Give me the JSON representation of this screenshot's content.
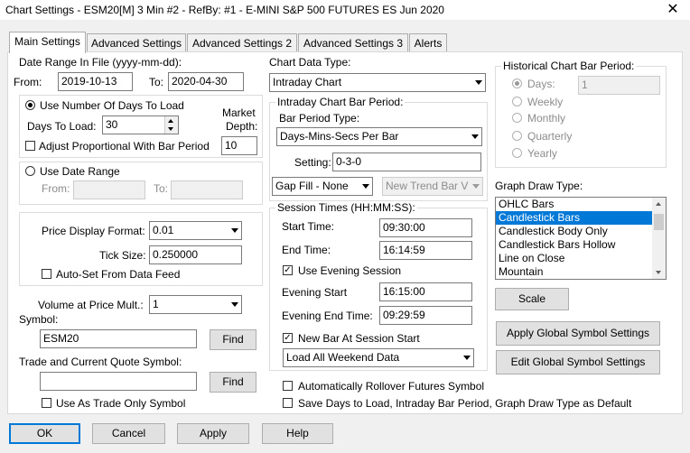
{
  "window": {
    "title": "Chart Settings - ESM20[M]  3 Min  #2 - RefBy: #1 - E-MINI S&P 500 FUTURES ES Jun 2020",
    "close_glyph": "✕"
  },
  "tabs": [
    {
      "label": "Main Settings"
    },
    {
      "label": "Advanced Settings"
    },
    {
      "label": "Advanced Settings 2"
    },
    {
      "label": "Advanced Settings 3"
    },
    {
      "label": "Alerts"
    }
  ],
  "date_range": {
    "label": "Date Range In File (yyyy-mm-dd):",
    "from_label": "From:",
    "from_value": "2019-10-13",
    "to_label": "To:",
    "to_value": "2020-04-30"
  },
  "days_group": {
    "use_days_label": "Use Number Of Days To Load",
    "days_label": "Days To Load:",
    "days_value": "30",
    "market_depth_label_1": "Market",
    "market_depth_label_2": "Depth:",
    "market_depth_value": "10",
    "adjust_label": "Adjust Proportional With Bar Period"
  },
  "date_group": {
    "use_date_label": "Use Date Range",
    "from_label": "From:",
    "to_label": "To:"
  },
  "price_group": {
    "format_label": "Price Display Format:",
    "format_value": "0.01",
    "tick_label": "Tick Size:",
    "tick_value": "0.250000",
    "autoset_label": "Auto-Set From Data Feed"
  },
  "volume": {
    "label": "Volume at Price Mult.:",
    "value": "1"
  },
  "symbol": {
    "label": "Symbol:",
    "value": "ESM20",
    "find_label": "Find"
  },
  "trade_symbol": {
    "label": "Trade and Current Quote Symbol:",
    "value": "",
    "find_label": "Find",
    "trade_only_label": "Use As Trade Only Symbol"
  },
  "chart_data_type": {
    "label": "Chart Data Type:",
    "value": "Intraday Chart"
  },
  "intraday": {
    "group_label": "Intraday Chart Bar Period:",
    "type_label": "Bar Period Type:",
    "type_value": "Days-Mins-Secs Per Bar",
    "setting_label": "Setting:",
    "setting_value": "0-3-0",
    "gap_fill_value": "Gap Fill - None",
    "new_trend_value": "New Trend Bar V"
  },
  "session": {
    "group_label": "Session Times (HH:MM:SS):",
    "start_label": "Start Time:",
    "start_value": "09:30:00",
    "end_label": "End Time:",
    "end_value": "16:14:59",
    "evening_label": "Use Evening Session",
    "evening_start_label": "Evening Start",
    "evening_start_value": "16:15:00",
    "evening_end_label": "Evening End Time:",
    "evening_end_value": "09:29:59",
    "new_bar_label": "New Bar At Session Start",
    "load_value": "Load All Weekend Data"
  },
  "rollover_label": "Automatically Rollover Futures Symbol",
  "save_default_label": "Save Days to Load, Intraday Bar Period, Graph Draw Type as Default",
  "historical": {
    "group_label": "Historical Chart Bar Period:",
    "days_label": "Days:",
    "days_value": "1",
    "weekly_label": "Weekly",
    "monthly_label": "Monthly",
    "quarterly_label": "Quarterly",
    "yearly_label": "Yearly"
  },
  "graph_draw": {
    "label": "Graph Draw Type:",
    "items": [
      "OHLC Bars",
      "Candlestick Bars",
      "Candlestick Body Only",
      "Candlestick Bars Hollow",
      "Line on Close",
      "Mountain"
    ],
    "selected": "Candlestick Bars"
  },
  "buttons": {
    "scale": "Scale",
    "apply_global": "Apply Global Symbol Settings",
    "edit_global": "Edit Global Symbol Settings",
    "ok": "OK",
    "cancel": "Cancel",
    "apply": "Apply",
    "help": "Help"
  },
  "colors": {
    "selection": "#0078d7",
    "background": "#f0f0f0"
  }
}
